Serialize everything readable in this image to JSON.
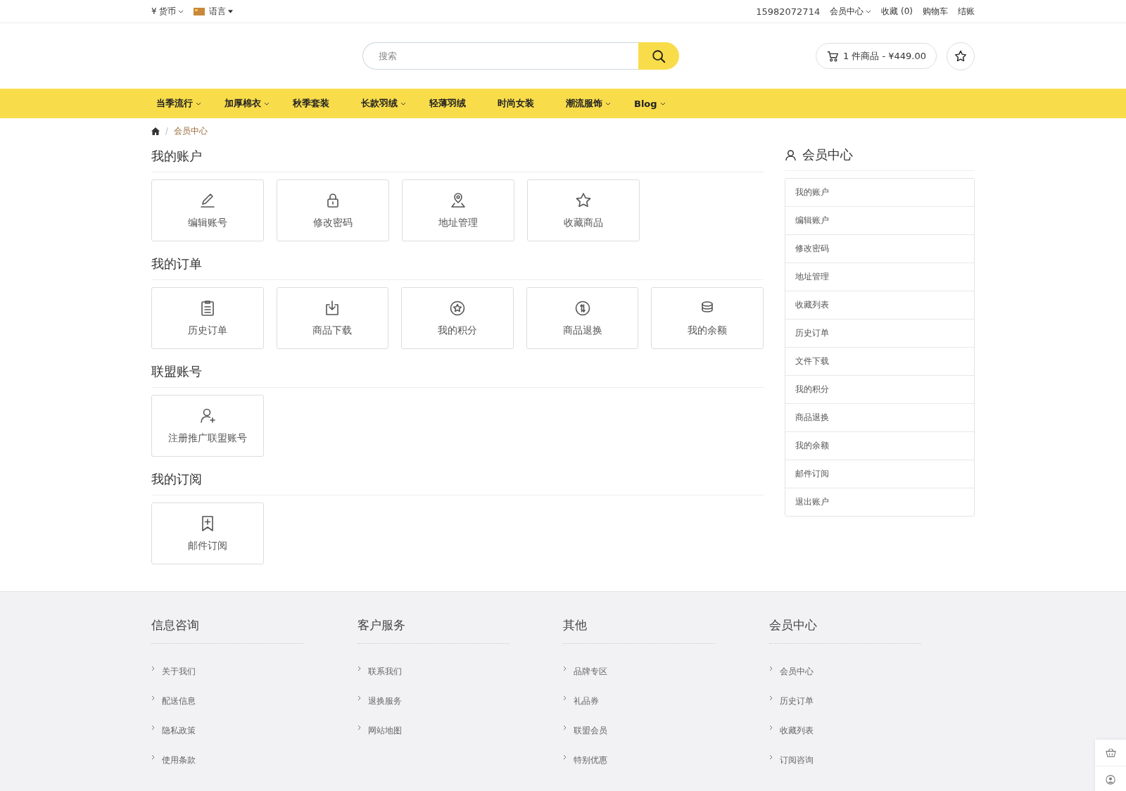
{
  "top_bar": {
    "currency": {
      "label": "¥ 货币",
      "has_menu": true
    },
    "language": {
      "label": "语言",
      "has_menu": true
    },
    "phone": "15982072714",
    "links": [
      {
        "label": "会员中心",
        "has_menu": true
      },
      {
        "label": "收藏 (0)",
        "has_menu": false
      },
      {
        "label": "购物车",
        "has_menu": false
      },
      {
        "label": "结账",
        "has_menu": false
      }
    ]
  },
  "header": {
    "search": {
      "placeholder": "搜索"
    },
    "cart": "1 件商品 - ¥449.00"
  },
  "nav": [
    {
      "label": "当季流行",
      "has_menu": true
    },
    {
      "label": "加厚棉衣",
      "has_menu": true
    },
    {
      "label": "秋季套装",
      "has_menu": false
    },
    {
      "label": "长款羽绒",
      "has_menu": true
    },
    {
      "label": "轻薄羽绒",
      "has_menu": false
    },
    {
      "label": "时尚女装",
      "has_menu": false
    },
    {
      "label": "潮流服饰",
      "has_menu": true
    },
    {
      "label": "Blog",
      "has_menu": true
    }
  ],
  "breadcrumb": [
    {
      "separator": "/",
      "label": "会员中心"
    }
  ],
  "sections": [
    {
      "title": "我的账户",
      "cards": [
        "编辑账号",
        "修改密码",
        "地址管理",
        "收藏商品"
      ]
    },
    {
      "title": "我的订单",
      "cards": [
        "历史订单",
        "商品下载",
        "我的积分",
        "商品退换",
        "我的余额"
      ]
    },
    {
      "title": "联盟账号",
      "cards": [
        "注册推广联盟账号"
      ]
    },
    {
      "title": "我的订阅",
      "cards": [
        "邮件订阅"
      ]
    }
  ],
  "sidebar": {
    "title": "会员中心",
    "items": [
      "我的账户",
      "编辑账户",
      "修改密码",
      "地址管理",
      "收藏列表",
      "历史订单",
      "文件下载",
      "我的积分",
      "商品退换",
      "我的余额",
      "邮件订阅",
      "退出账户"
    ]
  },
  "footer": [
    {
      "title": "信息咨询",
      "links": [
        "关于我们",
        "配送信息",
        "隐私政策",
        "使用条款"
      ]
    },
    {
      "title": "客户服务",
      "links": [
        "联系我们",
        "退换服务",
        "网站地图"
      ]
    },
    {
      "title": "其他",
      "links": [
        "品牌专区",
        "礼品券",
        "联盟会员",
        "特别优惠"
      ]
    },
    {
      "title": "会员中心",
      "links": [
        "会员中心",
        "历史订单",
        "收藏列表",
        "订阅咨询"
      ]
    }
  ]
}
